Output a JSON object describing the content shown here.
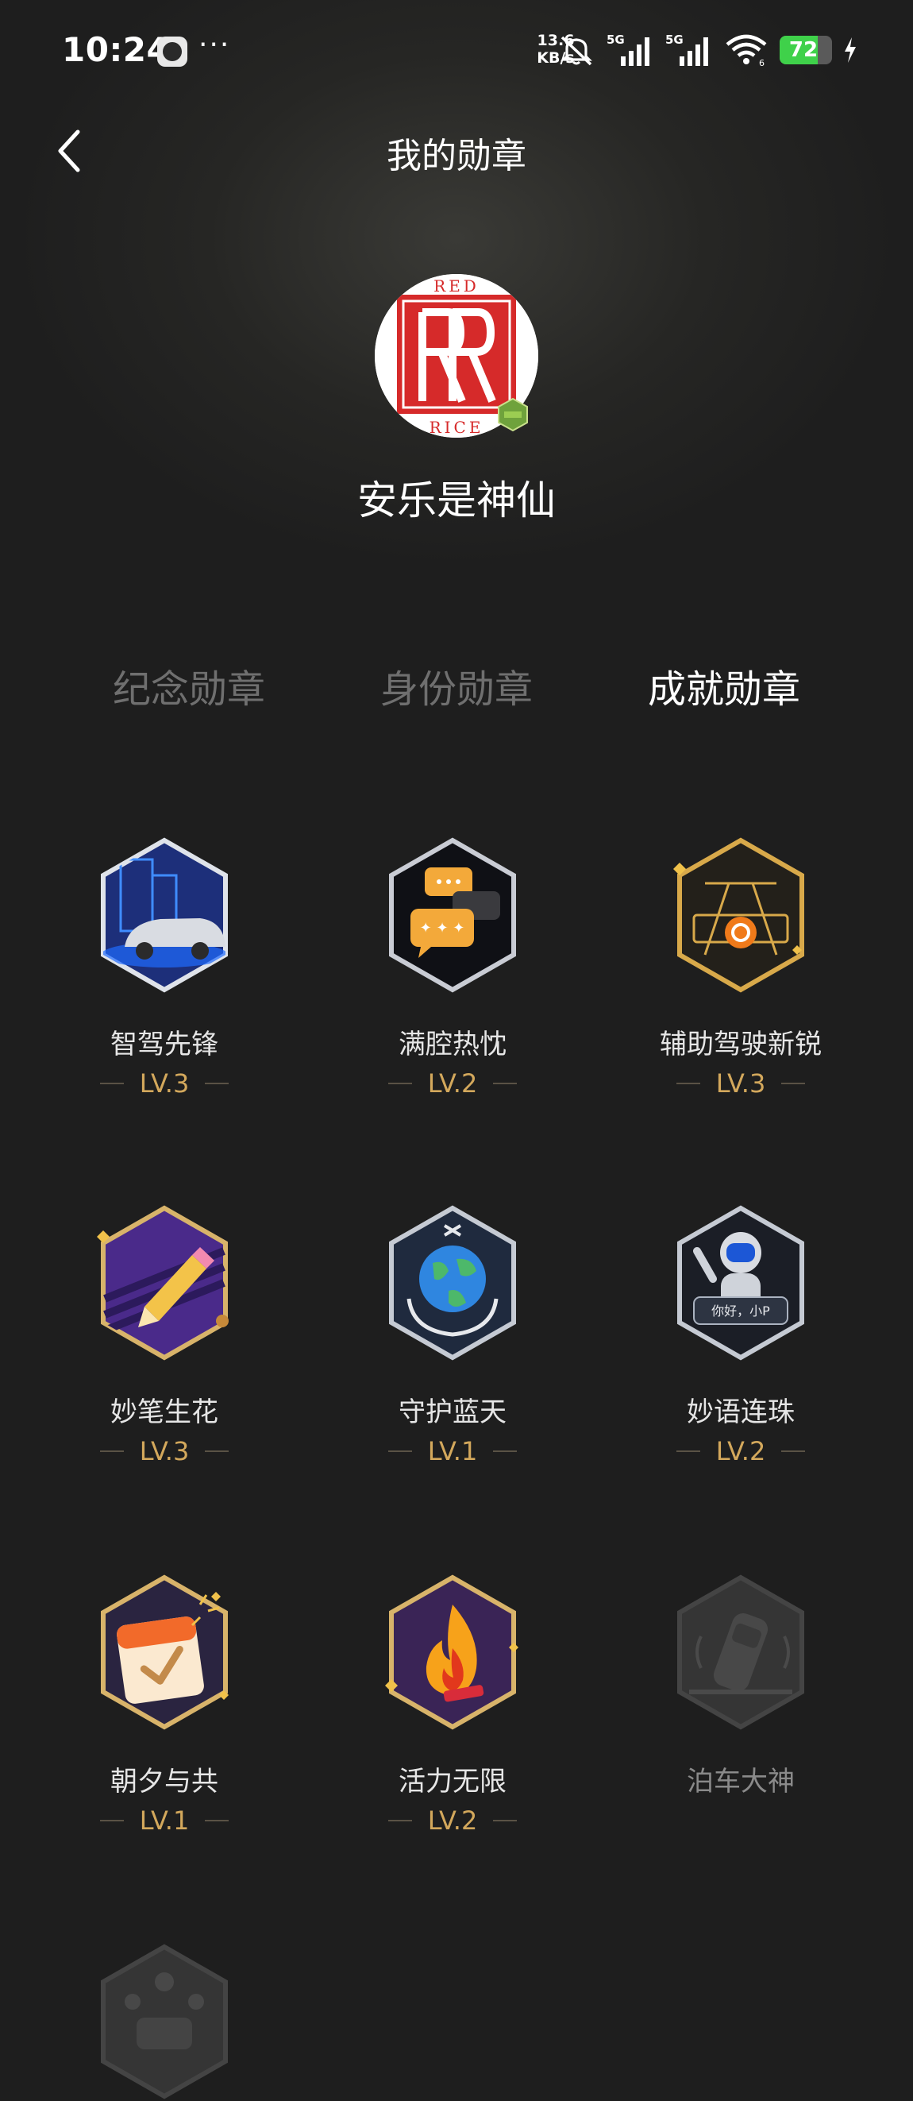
{
  "status_bar": {
    "time": "10:24",
    "dots": "···",
    "speed_value": "13.6",
    "speed_unit": "KB/s",
    "battery_level": "72",
    "battery_percent": 72
  },
  "header": {
    "title": "我的勋章"
  },
  "profile": {
    "name": "安乐是神仙",
    "avatar_text_top": "RED",
    "avatar_text_bottom": "RICE"
  },
  "tabs": [
    {
      "label": "纪念勋章",
      "active": false
    },
    {
      "label": "身份勋章",
      "active": false
    },
    {
      "label": "成就勋章",
      "active": true
    }
  ],
  "badges": [
    {
      "name": "智驾先锋",
      "level": "LV.3",
      "icon": "autopilot-car-icon",
      "locked": false
    },
    {
      "name": "满腔热忱",
      "level": "LV.2",
      "icon": "chat-bubbles-icon",
      "locked": false
    },
    {
      "name": "辅助驾驶新锐",
      "level": "LV.3",
      "icon": "road-steering-icon",
      "locked": false
    },
    {
      "name": "妙笔生花",
      "level": "LV.3",
      "icon": "pencil-icon",
      "locked": false
    },
    {
      "name": "守护蓝天",
      "level": "LV.1",
      "icon": "earth-hands-icon",
      "locked": false
    },
    {
      "name": "妙语连珠",
      "level": "LV.2",
      "icon": "robot-assistant-icon",
      "locked": false
    },
    {
      "name": "朝夕与共",
      "level": "LV.1",
      "icon": "calendar-check-icon",
      "locked": false
    },
    {
      "name": "活力无限",
      "level": "LV.2",
      "icon": "flame-icon",
      "locked": false
    },
    {
      "name": "泊车大神",
      "level": "",
      "icon": "parking-car-icon",
      "locked": true
    },
    {
      "name": "",
      "level": "",
      "icon": "locked-dashboard-icon",
      "locked": true
    }
  ],
  "robot_badge_text": "你好，小P"
}
